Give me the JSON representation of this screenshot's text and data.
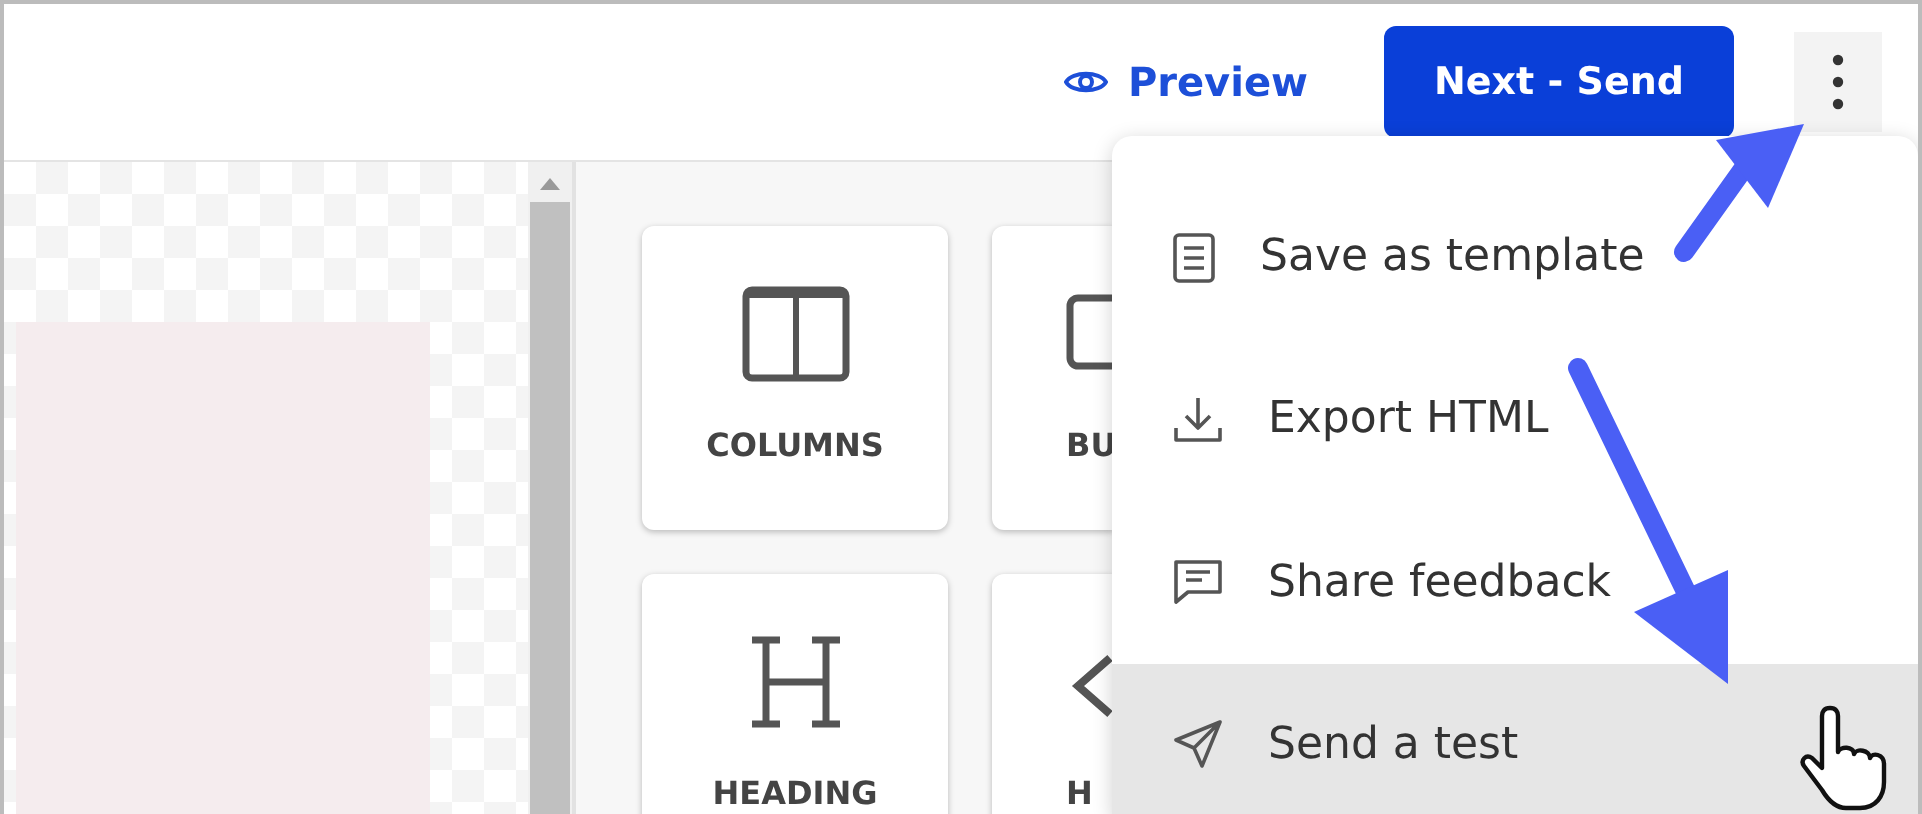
{
  "header": {
    "preview": {
      "label": "Preview"
    },
    "primary_button": {
      "label": "Next - Send"
    }
  },
  "blocks": [
    {
      "label": "COLUMNS",
      "kind": "columns",
      "clipped": false
    },
    {
      "label": "BU",
      "kind": "button",
      "clipped": true
    },
    {
      "label": "HEADING",
      "kind": "heading",
      "clipped": false
    },
    {
      "label": "H",
      "kind": "html",
      "clipped": true
    }
  ],
  "menu": {
    "items": [
      {
        "label": "Save as template",
        "kind": "template",
        "highlighted": false
      },
      {
        "label": "Export HTML",
        "kind": "export",
        "highlighted": false
      },
      {
        "label": "Share feedback",
        "kind": "feedback",
        "highlighted": false
      },
      {
        "label": "Send a test",
        "kind": "send",
        "highlighted": true
      }
    ]
  }
}
